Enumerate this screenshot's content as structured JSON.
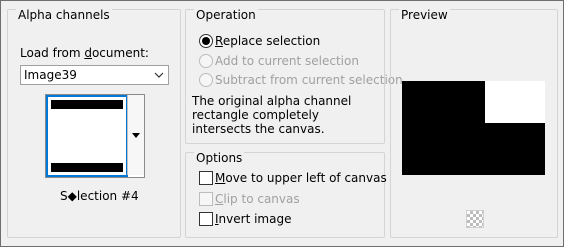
{
  "alpha_channels": {
    "title": "Alpha channels",
    "load_label": "Load from document:",
    "document_value": "Image39",
    "selection_name": "S◆lection #4"
  },
  "operation": {
    "title": "Operation",
    "replace": "Replace selection",
    "add": "Add to current selection",
    "subtract": "Subtract from current selection",
    "description": "The original alpha channel rectangle completely intersects the canvas."
  },
  "options": {
    "title": "Options",
    "move_upper_left": "Move to upper left of canvas",
    "clip": "Clip to canvas",
    "invert": "Invert image"
  },
  "preview": {
    "title": "Preview"
  },
  "colors": {
    "accent": "#0078d7",
    "border": "#d4d4d4",
    "background": "#f0f0f0"
  }
}
